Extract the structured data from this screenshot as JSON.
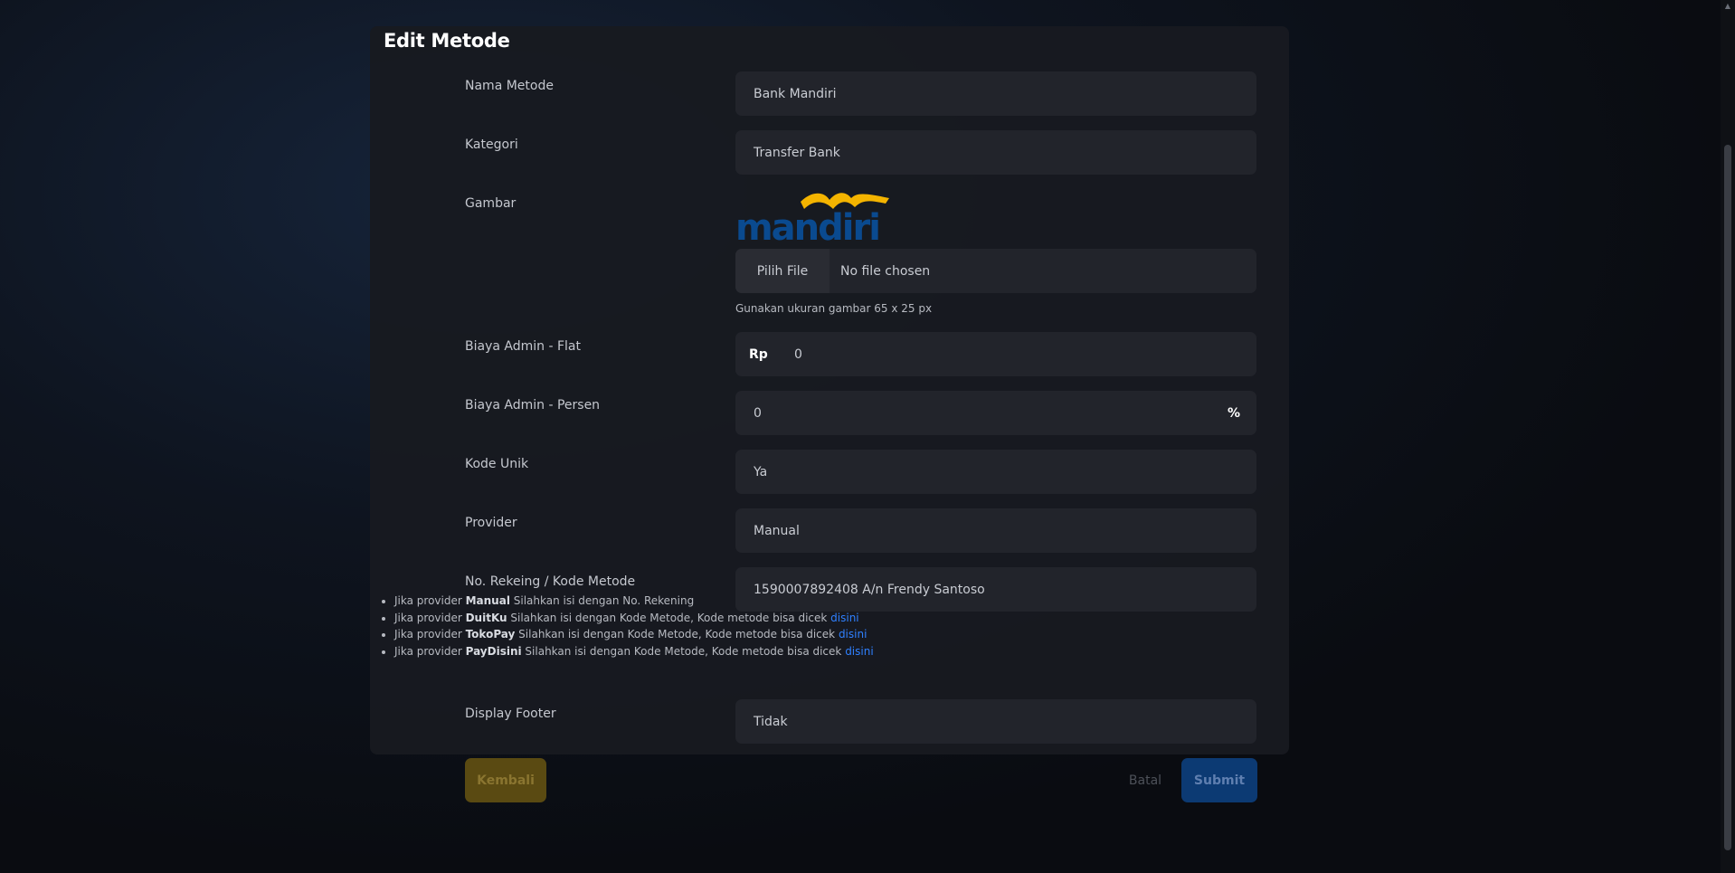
{
  "modal": {
    "title": "Edit Metode"
  },
  "form": {
    "nama_metode": {
      "label": "Nama Metode",
      "value": "Bank Mandiri"
    },
    "kategori": {
      "label": "Kategori",
      "value": "Transfer Bank"
    },
    "gambar": {
      "label": "Gambar",
      "logo_text": "mandiri",
      "file_button": "Pilih File",
      "file_status": "No file chosen",
      "hint": "Gunakan ukuran gambar 65 x 25 px"
    },
    "biaya_flat": {
      "label": "Biaya Admin - Flat",
      "prefix": "Rp",
      "value": "0"
    },
    "biaya_persen": {
      "label": "Biaya Admin - Persen",
      "value": "0",
      "suffix": "%"
    },
    "kode_unik": {
      "label": "Kode Unik",
      "value": "Ya"
    },
    "provider": {
      "label": "Provider",
      "value": "Manual"
    },
    "rekening": {
      "label": "No. Rekeing / Kode Metode",
      "value": "1590007892408 A/n Frendy Santoso",
      "notes": [
        {
          "prefix": "Jika provider ",
          "bold": "Manual",
          "text": " Silahkan isi dengan No. Rekening",
          "link": ""
        },
        {
          "prefix": "Jika provider ",
          "bold": "DuitKu",
          "text": " Silahkan isi dengan Kode Metode, Kode metode bisa dicek ",
          "link": "disini"
        },
        {
          "prefix": "Jika provider ",
          "bold": "TokoPay",
          "text": " Silahkan isi dengan Kode Metode, Kode metode bisa dicek ",
          "link": "disini"
        },
        {
          "prefix": "Jika provider ",
          "bold": "PayDisini",
          "text": " Silahkan isi dengan Kode Metode, Kode metode bisa dicek ",
          "link": "disini"
        }
      ]
    },
    "display_footer": {
      "label": "Display Footer",
      "value": "Tidak"
    }
  },
  "actions": {
    "back": "Kembali",
    "cancel": "Batal",
    "submit": "Submit"
  },
  "colors": {
    "brand_blue": "#0a4a8f",
    "brand_gold": "#f4b400",
    "link": "#2f80ff",
    "back_button": "#5a4a12",
    "submit_button": "#0c3a73"
  }
}
